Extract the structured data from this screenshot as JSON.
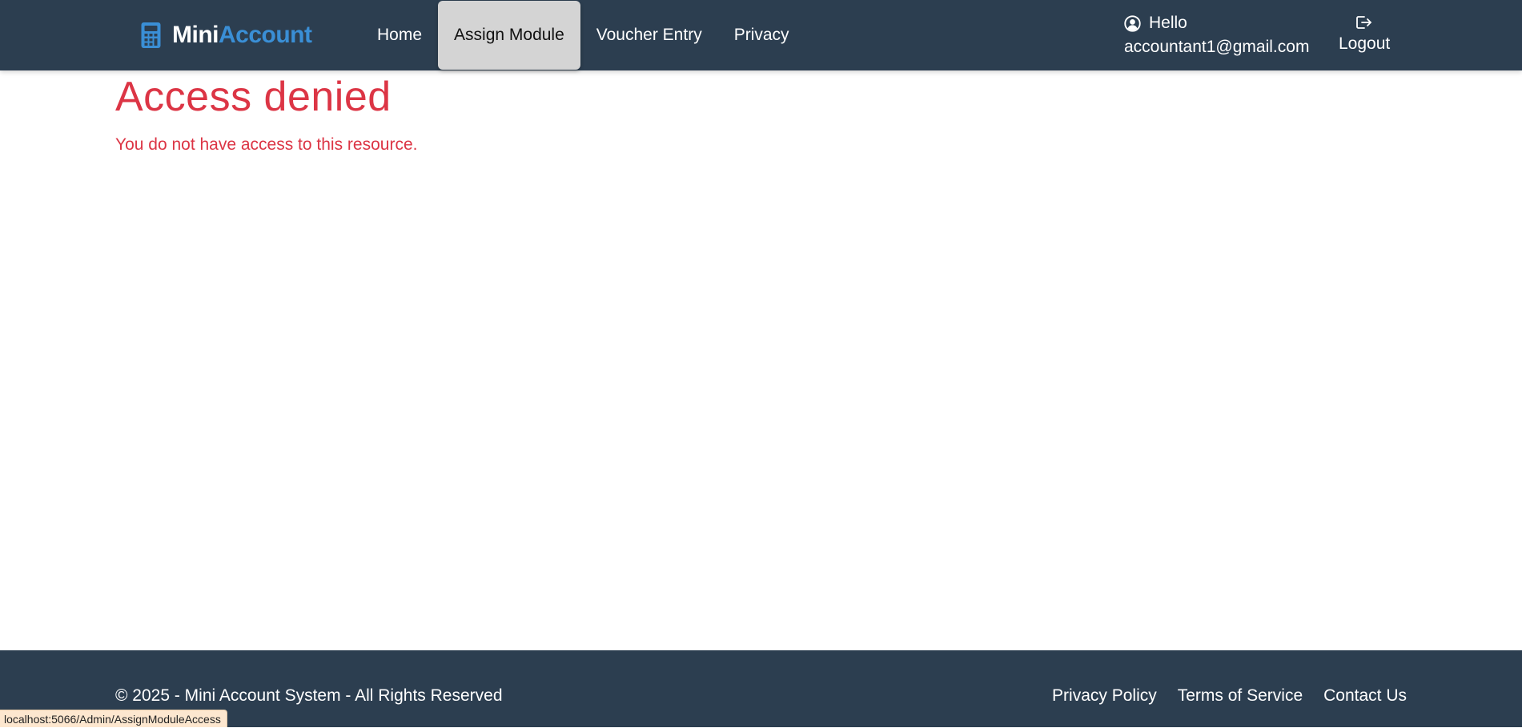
{
  "navbar": {
    "brand_part1": "Mini",
    "brand_part2": "Account",
    "links": [
      {
        "label": "Home"
      },
      {
        "label": "Assign Module",
        "active": true
      },
      {
        "label": "Voucher Entry"
      },
      {
        "label": "Privacy"
      }
    ],
    "greeting": "Hello",
    "user_email": "accountant1@gmail.com",
    "logout_label": "Logout",
    "icons": {
      "brand": "calculator-icon",
      "user": "user-circle-icon",
      "logout": "logout-icon"
    }
  },
  "main": {
    "title": "Access denied",
    "message": "You do not have access to this resource."
  },
  "footer": {
    "copyright": "© 2025 - Mini Account System - All Rights Reserved",
    "links": [
      {
        "label": "Privacy Policy"
      },
      {
        "label": "Terms of Service"
      },
      {
        "label": "Contact Us"
      }
    ]
  },
  "status_bar": {
    "url": "localhost:5066/Admin/AssignModuleAccess"
  },
  "colors": {
    "nav_bg": "#2c3e50",
    "brand_accent": "#3a8fd6",
    "active_tab_bg": "#d4d4d4",
    "error": "#dc3545",
    "status_bg": "#fde7cf"
  }
}
